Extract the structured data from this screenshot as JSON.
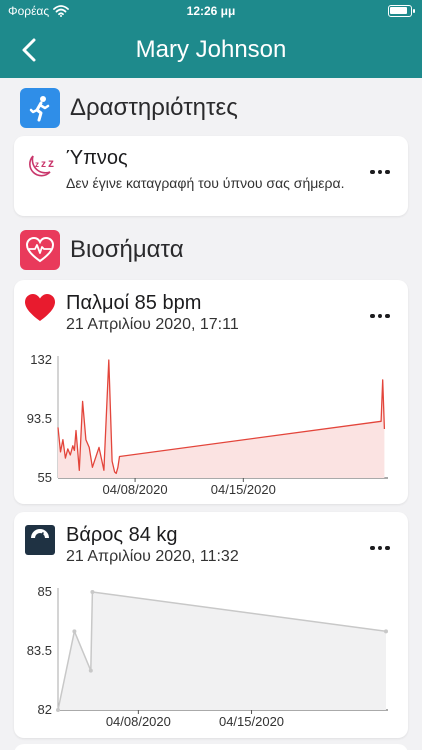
{
  "status_bar": {
    "carrier": "Φορέας",
    "time": "12:26 μμ"
  },
  "nav": {
    "title": "Mary Johnson",
    "back_icon": "chevron-left-icon"
  },
  "colors": {
    "header": "#1e8a8c",
    "activities": "#2f8ee8",
    "vitals": "#e93a5b",
    "heart_line": "#e3453b",
    "heart_fill": "#fbe3e2",
    "weight_line": "#c8c8c8",
    "weight_fill": "#f1f1f2"
  },
  "activities": {
    "title": "Δραστηριότητες",
    "icon": "running-person-icon",
    "sleep": {
      "icon": "sleep-zzz-icon",
      "title": "Ύπνος",
      "description": "Δεν έγινε καταγραφή του ύπνου σας σήμερα."
    }
  },
  "vitals": {
    "title": "Βιοσήματα",
    "icon": "heart-pulse-icon",
    "heart": {
      "icon": "heart-icon",
      "title": "Παλμοί 85 bpm",
      "date": "21 Απριλίου 2020, 17:11"
    },
    "weight": {
      "icon": "scale-icon",
      "title": "Βάρος 84 kg",
      "date": "21 Απριλίου 2020, 11:32"
    }
  },
  "chart_data": [
    {
      "type": "area",
      "ylim": [
        55,
        132
      ],
      "yticks": [
        "132",
        "93.5",
        "55"
      ],
      "xticks": [
        "04/08/2020",
        "04/15/2020"
      ],
      "x_range": [
        0,
        20
      ],
      "xtick_pos": [
        4.7,
        11.3
      ],
      "grid": false,
      "series": [
        {
          "x": [
            0,
            0.15,
            0.3,
            0.45,
            0.6,
            0.75,
            0.9,
            1.0,
            1.1,
            1.3,
            1.5,
            1.7,
            1.9,
            2.1,
            2.5,
            2.8,
            3.1,
            3.3,
            3.45,
            3.55,
            3.65,
            3.75,
            19.7,
            19.8,
            19.9
          ],
          "values": [
            88,
            72,
            80,
            68,
            74,
            70,
            76,
            73,
            86,
            60,
            105,
            80,
            75,
            62,
            75,
            60,
            132,
            66,
            59,
            58,
            62,
            69,
            92,
            119,
            87
          ]
        }
      ]
    },
    {
      "type": "area",
      "ylim": [
        82,
        85
      ],
      "yticks": [
        "85",
        "83.5",
        "82"
      ],
      "xticks": [
        "04/08/2020",
        "04/15/2020"
      ],
      "x_range": [
        0,
        20
      ],
      "xtick_pos": [
        4.9,
        11.8
      ],
      "grid": false,
      "series": [
        {
          "x": [
            0,
            1.0,
            2.0,
            2.1,
            20
          ],
          "values": [
            82,
            84.0,
            83.0,
            85.0,
            84.0
          ]
        }
      ]
    }
  ]
}
